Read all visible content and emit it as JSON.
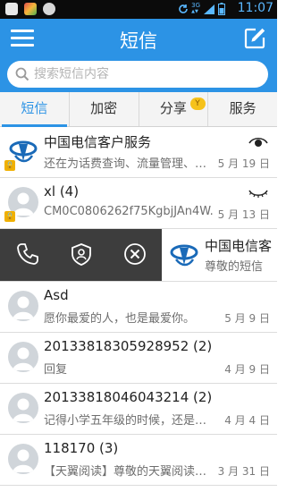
{
  "status_bar": {
    "time": "11:07",
    "network": "3G",
    "signal_bars": "4"
  },
  "header": {
    "title": "短信"
  },
  "search": {
    "placeholder": "搜索短信内容"
  },
  "tabs": [
    {
      "label": "短信",
      "active": true
    },
    {
      "label": "加密",
      "active": false
    },
    {
      "label": "分享",
      "active": false,
      "badge": "Y"
    },
    {
      "label": "服务",
      "active": false
    }
  ],
  "conversations": [
    {
      "name": "中国电信客户服务",
      "snippet": "还在为话费查询、流量管理、…",
      "date": "5 月 19 日",
      "avatar": "china-telecom-logo",
      "locked": true,
      "icon": "eye-open-icon"
    },
    {
      "name": "xl (4)",
      "snippet": "CM0C0806262f75KgbjJAn4W.",
      "date": "5 月 13 日",
      "avatar": "default-person",
      "locked": true,
      "icon": "eye-closed-icon"
    }
  ],
  "swiped_row": {
    "name": "中国电信客",
    "snippet": "尊敬的短信",
    "actions": [
      "phone-icon",
      "shield-icon",
      "close-circle-icon"
    ]
  },
  "more_conversations": [
    {
      "name": "Asd",
      "snippet": "愿你最爱的人，也是最爱你。",
      "date": "5 月 9 日"
    },
    {
      "name": "20133818305928952 (2)",
      "snippet": "回复",
      "date": "4 月 9 日"
    },
    {
      "name": "20133818046043214 (2)",
      "snippet": "记得小学五年级的时候，还是w…",
      "date": "4 月 4 日"
    },
    {
      "name": "118170 (3)",
      "snippet": "【天翼阅读】尊敬的天翼阅读…",
      "date": "3 月 31 日"
    }
  ],
  "colors": {
    "accent": "#2c93e5",
    "action_bar": "#3d3d3d",
    "lock": "#f0b000"
  }
}
